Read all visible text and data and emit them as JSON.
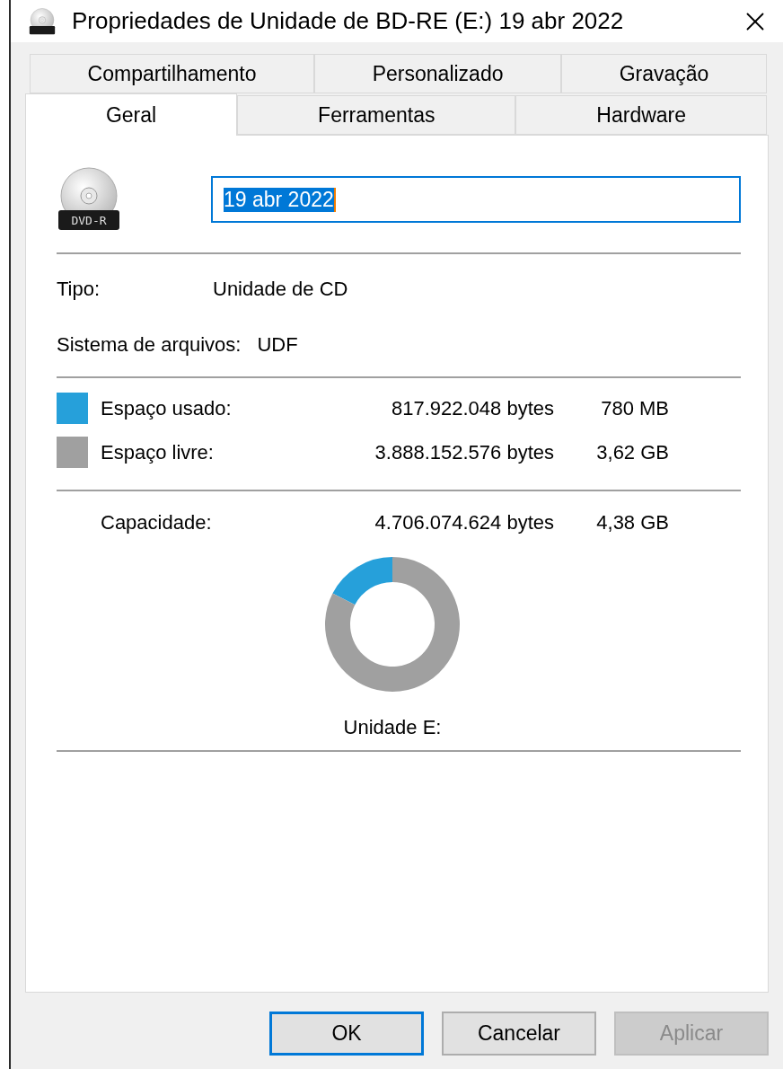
{
  "window": {
    "title": "Propriedades de Unidade de BD-RE (E:) 19 abr 2022"
  },
  "tabs": {
    "rows": [
      [
        {
          "label": "Compartilhamento",
          "selected": false
        },
        {
          "label": "Personalizado",
          "selected": false
        },
        {
          "label": "Gravação",
          "selected": false
        }
      ],
      [
        {
          "label": "Geral",
          "selected": true
        },
        {
          "label": "Ferramentas",
          "selected": false
        },
        {
          "label": "Hardware",
          "selected": false
        }
      ]
    ]
  },
  "drive": {
    "badge": "DVD-R",
    "name_value": "19 abr 2022",
    "text_selected": true
  },
  "info": [
    {
      "label": "Tipo:",
      "value": "Unidade de CD"
    },
    {
      "label": "Sistema de arquivos:",
      "value": "UDF"
    }
  ],
  "usage": [
    {
      "label": "Espaço usado:",
      "bytes": "817.922.048 bytes",
      "size": "780 MB",
      "color": "#26a0da"
    },
    {
      "label": "Espaço livre:",
      "bytes": "3.888.152.576 bytes",
      "size": "3,62 GB",
      "color": "#a0a0a0"
    }
  ],
  "capacity": {
    "label": "Capacidade:",
    "bytes": "4.706.074.624 bytes",
    "size": "4,38 GB"
  },
  "chart": {
    "caption": "Unidade E:",
    "chart_data": {
      "type": "donut",
      "values": [
        17.38,
        82.62
      ]
    }
  },
  "buttons": [
    {
      "label": "OK",
      "kind": "default",
      "disabled": false
    },
    {
      "label": "Cancelar",
      "kind": "normal",
      "disabled": false
    },
    {
      "label": "Aplicar",
      "kind": "normal",
      "disabled": true
    }
  ]
}
